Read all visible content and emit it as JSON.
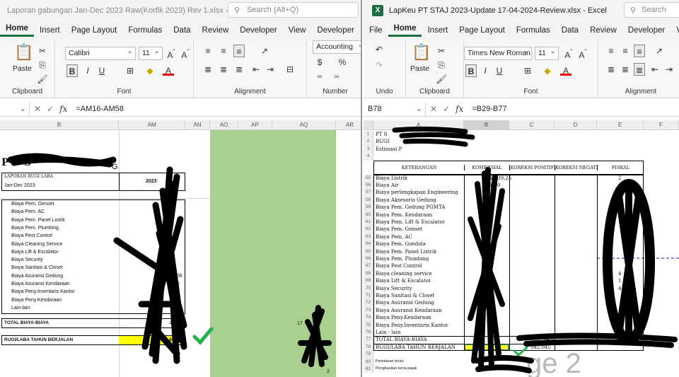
{
  "left_window": {
    "title": "Laporan gabungan Jan-Dec 2023 Raw(Korfik 2023) Rev 1.xlsx  -  Excel",
    "search_placeholder": "Search (Alt+Q)",
    "menu": [
      "Home",
      "Insert",
      "Page Layout",
      "Formulas",
      "Data",
      "Review",
      "Developer",
      "View",
      "Developer",
      "Help"
    ],
    "active_menu": "Home",
    "ribbon": {
      "paste": "Paste",
      "font_name": "Calibri",
      "font_size": "11",
      "number_format": "Accounting",
      "groups": [
        "Clipboard",
        "Font",
        "Alignment",
        "Number"
      ]
    },
    "name_box": "",
    "formula": "=AM16-AM58",
    "columns": [
      "B",
      "AM",
      "AN",
      "AO",
      "AP",
      "AQ",
      "AR"
    ],
    "company": "PT S",
    "company_suffix": "G",
    "report_title": "LAPORAN RUGI LABA",
    "period": "Jan-Dec 2023",
    "year": "2023",
    "cost_items": [
      "Biaya Pem. Genset",
      "Biaya Pem. AC",
      "Biaya Pem. Panel Listrik",
      "Biaya Pem. Plumbing",
      "Biaya Pest Control",
      "Biaya Cleaning Service",
      "Biaya Lift & Escalator",
      "Biaya Security",
      "Biaya Sanitasi & Closet",
      "Biaya Asuransi Gedung",
      "Biaya Asuransi Kendaraan",
      "Biaya Peny.Inventaris Kantor",
      "Biaya Peny.Kendaraan",
      "Lain-lain"
    ],
    "partial_values": [
      "",
      "",
      "",
      "",
      "",
      "",
      "",
      "",
      "",
      ".006",
      ".76",
      ".56",
      ".00",
      ".17"
    ],
    "total_label": "TOTAL BIAYA-BIAYA",
    "total_value": "2.61",
    "profit_label": "RUGI/LABA TAHUN BERJALAN",
    "profit_value": "1.666",
    "aq_total": "17",
    "aq_bottom": "2"
  },
  "right_window": {
    "title": "LapKeu PT STAJ 2023-Update 17-04-2024-Review.xlsx  -  Excel",
    "search_placeholder": "Search",
    "menu": [
      "File",
      "Home",
      "Insert",
      "Page Layout",
      "Formulas",
      "Data",
      "Review",
      "Developer",
      "View"
    ],
    "active_menu": "Home",
    "ribbon": {
      "paste": "Paste",
      "font_name": "Times New Roman",
      "font_size": "11",
      "groups": [
        "Undo",
        "Clipboard",
        "Font",
        "Alignment"
      ]
    },
    "name_box": "B78",
    "formula": "=B29-B77",
    "columns": [
      "A",
      "B",
      "C",
      "D",
      "E",
      "F"
    ],
    "header_rows": [
      {
        "num": "1",
        "text": "PT S"
      },
      {
        "num": "2",
        "text": "RUGI"
      },
      {
        "num": "3",
        "text": "Estimasi P"
      },
      {
        "num": "4",
        "text": ""
      }
    ],
    "table_headers": [
      "KETERANGAN",
      "KOMERSIAL",
      "KOREKSI POSITIF",
      "KOREKSI NEGATIF",
      "FISKAL"
    ],
    "rows": [
      {
        "num": "55",
        "label": "Biaya Listrik",
        "kom": "4.039.25",
        "fis": "2"
      },
      {
        "num": "56",
        "label": "Biaya Air",
        "kom": "1.00",
        "fis": ""
      },
      {
        "num": "57",
        "label": "Biaya perlengkapan Engineering",
        "kom": "",
        "fis": ""
      },
      {
        "num": "58",
        "label": "Biaya Aksesoris Gedung",
        "kom": "",
        "fis": ""
      },
      {
        "num": "59",
        "label": "Biaya Pem. Gedung PGMTA",
        "kom": "",
        "fis": ""
      },
      {
        "num": "60",
        "label": "Biaya Pem. Kendaraan",
        "kom": "",
        "fis": ""
      },
      {
        "num": "61",
        "label": "Biaya Pem. Lift & Escalator",
        "kom": "",
        "fis": ""
      },
      {
        "num": "62",
        "label": "Biaya Pem. Genset",
        "kom": "",
        "fis": ""
      },
      {
        "num": "63",
        "label": "Biaya Pem. AC",
        "kom": "",
        "fis": ""
      },
      {
        "num": "64",
        "label": "Biaya Pem. Gondola",
        "kom": "",
        "fis": ""
      },
      {
        "num": "65",
        "label": "Biaya Pem. Panel Listrik",
        "kom": "",
        "fis": ""
      },
      {
        "num": "66",
        "label": "Biaya Pem. Plumbing",
        "kom": "",
        "fis": ""
      },
      {
        "num": "67",
        "label": "Biaya Pest Control",
        "kom": "",
        "fis": ""
      },
      {
        "num": "68",
        "label": "Biaya cleaning service",
        "kom": "",
        "fis": "4"
      },
      {
        "num": "69",
        "label": "Biaya Lift & Escalator",
        "kom": "",
        "fis": "1"
      },
      {
        "num": "70",
        "label": "Biaya Security",
        "kom": "4",
        "fis": "4"
      },
      {
        "num": "71",
        "label": "Biaya Sanitasi & Closet",
        "kom": "",
        "fis": ""
      },
      {
        "num": "72",
        "label": "Biaya Asuransi Gedung",
        "kom": "",
        "fis": ""
      },
      {
        "num": "73",
        "label": "Biaya Asuransi Kendaraan",
        "kom": "",
        "fis": ""
      },
      {
        "num": "74",
        "label": "Biaya Peny.Kendaraan",
        "kom": "",
        "fis": ""
      },
      {
        "num": "75",
        "label": "Biaya Peny.Inventaris Kantor",
        "kom": "",
        "fis": "1"
      },
      {
        "num": "76",
        "label": "Lain - lain",
        "kom": "",
        "fis": "54.1"
      },
      {
        "num": "77",
        "label": "TOTAL BIAYA-BIAYA",
        "kom": "17",
        "kp": "(542.045",
        "fis": ""
      },
      {
        "num": "78",
        "label": "RUGI/LABA TAHUN BERJALAN",
        "kom": "",
        "kp": "542.045",
        "fis": ""
      }
    ],
    "extra_rows": [
      {
        "num": "79",
        "text": ""
      },
      {
        "num": "80",
        "text": "Peredaran bruto"
      },
      {
        "num": "81",
        "text": "Penghasilan kena pajak"
      }
    ],
    "watermark": "ge 2"
  },
  "colors": {
    "excel_green": "#1d6f42",
    "highlight_yellow": "#ffff00",
    "sheet_green": "#a9d08e",
    "check_green": "#22b14c"
  }
}
